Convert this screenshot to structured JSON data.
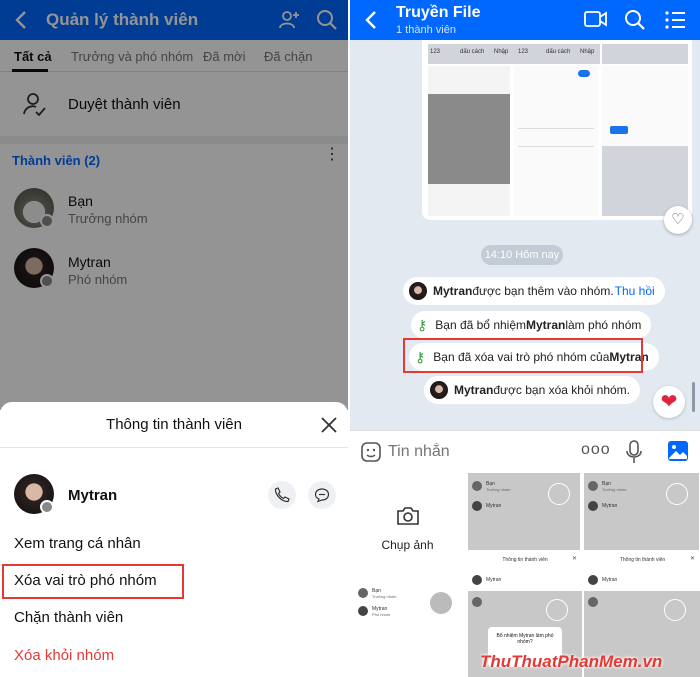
{
  "left": {
    "header": {
      "title": "Quản lý thành viên"
    },
    "tabs": [
      "Tất cả",
      "Trưởng và phó nhóm",
      "Đã mời",
      "Đã chặn"
    ],
    "approve_label": "Duyệt thành viên",
    "members_header": "Thành viên (2)",
    "members": [
      {
        "name": "Bạn",
        "role": "Trưởng nhóm"
      },
      {
        "name": "Mytran",
        "role": "Phó nhóm"
      }
    ],
    "sheet": {
      "title": "Thông tin thành viên",
      "member_name": "Mytran",
      "items": [
        "Xem trang cá nhân",
        "Xóa vai trò phó nhóm",
        "Chặn thành viên",
        "Xóa khỏi nhóm"
      ]
    }
  },
  "right": {
    "header": {
      "title": "Truyền File",
      "subtitle": "1 thành viên"
    },
    "keyboard": {
      "key_123": "123",
      "space_label": "dấu cách",
      "enter_label": "Nhập"
    },
    "time_divider": "14:10 Hôm nay",
    "events": [
      {
        "parts": [
          {
            "b": "Mytran"
          },
          {
            "t": " được bạn thêm vào nhóm. "
          },
          {
            "link": "Thu hồi"
          }
        ]
      },
      {
        "parts": [
          {
            "t": "Bạn đã bổ nhiệm "
          },
          {
            "b": "Mytran"
          },
          {
            "t": " làm phó nhóm"
          }
        ]
      },
      {
        "parts": [
          {
            "t": "Bạn đã xóa vai trò phó nhóm của "
          },
          {
            "b": "Mytran"
          }
        ]
      },
      {
        "parts": [
          {
            "b": "Mytran"
          },
          {
            "t": " được bạn xóa khỏi nhóm."
          }
        ]
      }
    ],
    "input_placeholder": "Tin nhắn",
    "camera_label": "Chụp ảnh",
    "thumbs": {
      "sheet_title": "Thông tin thành viên",
      "me": "Bạn",
      "me_role": "Trưởng nhóm",
      "member": "Mytran",
      "member_role": "Phó nhóm",
      "dialog_title": "Bổ nhiệm Mytran làm phó nhóm?"
    }
  },
  "watermark": "ThuThuatPhanMem.vn",
  "colors": {
    "brand": "#0068ff",
    "danger": "#e53935",
    "link": "#0068ff"
  }
}
